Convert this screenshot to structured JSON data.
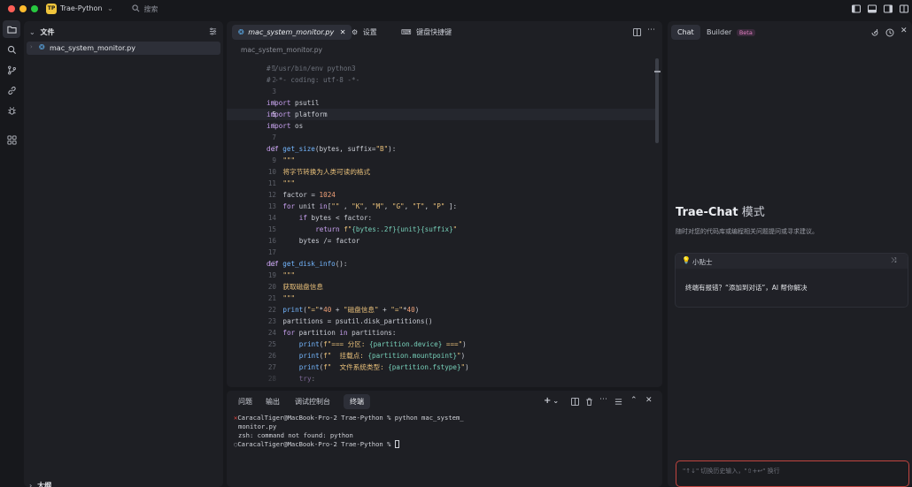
{
  "colors": {
    "close": "#ff5f57",
    "minimize": "#febc2e",
    "zoom": "#28c840",
    "accent": "#f0c53c",
    "error": "#e0443f",
    "panel": "#1e1f24",
    "background": "#17181c"
  },
  "titlebar": {
    "app_badge": "TP",
    "project": "Trae-Python",
    "search_placeholder": "搜索"
  },
  "sidebar": {
    "title": "文件",
    "file_name": "mac_system_monitor.py",
    "outline_label": "大纲"
  },
  "editor": {
    "tabs": [
      {
        "label": "mac_system_monitor.py",
        "active": true
      },
      {
        "label": "设置",
        "active": false
      },
      {
        "label": "键盘快捷键",
        "active": false
      }
    ],
    "breadcrumb": "mac_system_monitor.py",
    "current_line": 5,
    "lines": [
      [
        [
          "cm",
          "#!/usr/bin/env python3"
        ]
      ],
      [
        [
          "cm",
          "# -*- coding: utf-8 -*-"
        ]
      ],
      [],
      [
        [
          "kw",
          "import"
        ],
        [
          "",
          "psutil"
        ]
      ],
      [
        [
          "kw",
          "import"
        ],
        [
          "",
          "platform"
        ]
      ],
      [
        [
          "kw",
          "import"
        ],
        [
          "",
          "os"
        ]
      ],
      [],
      [
        [
          "kw",
          "def"
        ],
        [
          "",
          ""
        ],
        [
          "fn",
          "get_size"
        ],
        [
          "",
          "(bytes, suffix="
        ],
        [
          "st",
          "\"B\""
        ],
        [
          "",
          "):"
        ]
      ],
      [
        [
          "",
          ""
        ],
        [
          "st",
          "\"\"\""
        ]
      ],
      [
        [
          "",
          ""
        ],
        [
          "st",
          "将字节转换为人类可读的格式"
        ]
      ],
      [
        [
          "",
          ""
        ],
        [
          "st",
          "\"\"\""
        ]
      ],
      [
        [
          "",
          "factor = "
        ],
        [
          "nm",
          "1024"
        ]
      ],
      [
        [
          "",
          ""
        ],
        [
          "kw",
          "for"
        ],
        [
          "",
          "unit "
        ],
        [
          "kw",
          "in"
        ],
        [
          "",
          "["
        ],
        [
          "st",
          "\"\""
        ],
        [
          "",
          " , "
        ],
        [
          "st",
          "\"K\""
        ],
        [
          "",
          ", "
        ],
        [
          "st",
          "\"M\""
        ],
        [
          "",
          ", "
        ],
        [
          "st",
          "\"G\""
        ],
        [
          "",
          ", "
        ],
        [
          "st",
          "\"T\""
        ],
        [
          "",
          ", "
        ],
        [
          "st",
          "\"P\""
        ],
        [
          "",
          "]:"
        ]
      ],
      [
        [
          "",
          ""
        ],
        [
          "kw",
          "if"
        ],
        [
          "",
          "bytes < factor:"
        ]
      ],
      [
        [
          "",
          ""
        ],
        [
          "kw",
          "return"
        ],
        [
          "",
          ""
        ],
        [
          "st",
          "f\""
        ],
        [
          "fs",
          "{bytes:.2f}{unit}{suffix}"
        ],
        [
          "st",
          "\""
        ]
      ],
      [
        [
          "",
          "bytes /= factor"
        ]
      ],
      [],
      [
        [
          "kw",
          "def"
        ],
        [
          "",
          ""
        ],
        [
          "fn",
          "get_disk_info"
        ],
        [
          "",
          "():"
        ]
      ],
      [
        [
          "",
          ""
        ],
        [
          "st",
          "\"\"\""
        ]
      ],
      [
        [
          "",
          ""
        ],
        [
          "st",
          "获取磁盘信息"
        ]
      ],
      [
        [
          "",
          ""
        ],
        [
          "st",
          "\"\"\""
        ]
      ],
      [
        [
          "",
          ""
        ],
        [
          "fn",
          "print"
        ],
        [
          "",
          "("
        ],
        [
          "st",
          "\"=\""
        ],
        [
          "",
          "*"
        ],
        [
          "nm",
          "40"
        ],
        [
          "",
          " + "
        ],
        [
          "st",
          "\"磁盘信息\""
        ],
        [
          "",
          " + "
        ],
        [
          "st",
          "\"=\""
        ],
        [
          "",
          "*"
        ],
        [
          "nm",
          "40"
        ],
        [
          "",
          ")"
        ]
      ],
      [
        [
          "",
          "partitions = psutil.disk_partitions()"
        ]
      ],
      [
        [
          "",
          ""
        ],
        [
          "kw",
          "for"
        ],
        [
          "",
          "partition "
        ],
        [
          "kw",
          "in"
        ],
        [
          "",
          "partitions:"
        ]
      ],
      [
        [
          "",
          ""
        ],
        [
          "fn",
          "print"
        ],
        [
          "",
          "("
        ],
        [
          "st",
          "f\"=== 分区: "
        ],
        [
          "fs",
          "{partition.device}"
        ],
        [
          "st",
          " ===\""
        ],
        [
          "",
          ")"
        ]
      ],
      [
        [
          "",
          ""
        ],
        [
          "fn",
          "print"
        ],
        [
          "",
          "("
        ],
        [
          "st",
          "f\"  挂载点: "
        ],
        [
          "fs",
          "{partition.mountpoint}"
        ],
        [
          "st",
          "\""
        ],
        [
          "",
          ")"
        ]
      ],
      [
        [
          "",
          ""
        ],
        [
          "fn",
          "print"
        ],
        [
          "",
          "("
        ],
        [
          "st",
          "f\"  文件系统类型: "
        ],
        [
          "fs",
          "{partition.fstype}"
        ],
        [
          "st",
          "\""
        ],
        [
          "",
          ")"
        ]
      ],
      [
        [
          "",
          ""
        ],
        [
          "kw",
          "try"
        ],
        [
          "",
          ":"
        ]
      ]
    ],
    "indents": [
      0,
      0,
      0,
      0,
      0,
      0,
      0,
      0,
      1,
      1,
      1,
      1,
      1,
      2,
      3,
      2,
      0,
      0,
      1,
      1,
      1,
      1,
      1,
      1,
      2,
      2,
      2,
      2
    ]
  },
  "terminal": {
    "tabs": [
      "问题",
      "输出",
      "调试控制台",
      "终端"
    ],
    "active_tab": "终端",
    "lines": [
      {
        "marker": "✕",
        "text": "CaracalTiger@MacBook-Pro-2 Trae-Python % python mac_system_"
      },
      {
        "marker": "",
        "text": "monitor.py"
      },
      {
        "marker": "",
        "text": "zsh: command not found: python"
      },
      {
        "marker": "○",
        "text": "CaracalTiger@MacBook-Pro-2 Trae-Python % "
      }
    ]
  },
  "chat": {
    "tab_chat": "Chat",
    "tab_builder": "Builder",
    "beta_badge": "Beta",
    "heading_main": "Trae-Chat",
    "heading_mode": " 模式",
    "subtitle": "随时对您的代码库或编程相关问题提问或寻求建议。",
    "tip_title": "小贴士",
    "tip_text": "终端有报错？“添加到对话”，AI 帮你解决",
    "input_placeholder": "\"↑↓\" 切换历史输入，\"⇧+↩\" 换行"
  }
}
